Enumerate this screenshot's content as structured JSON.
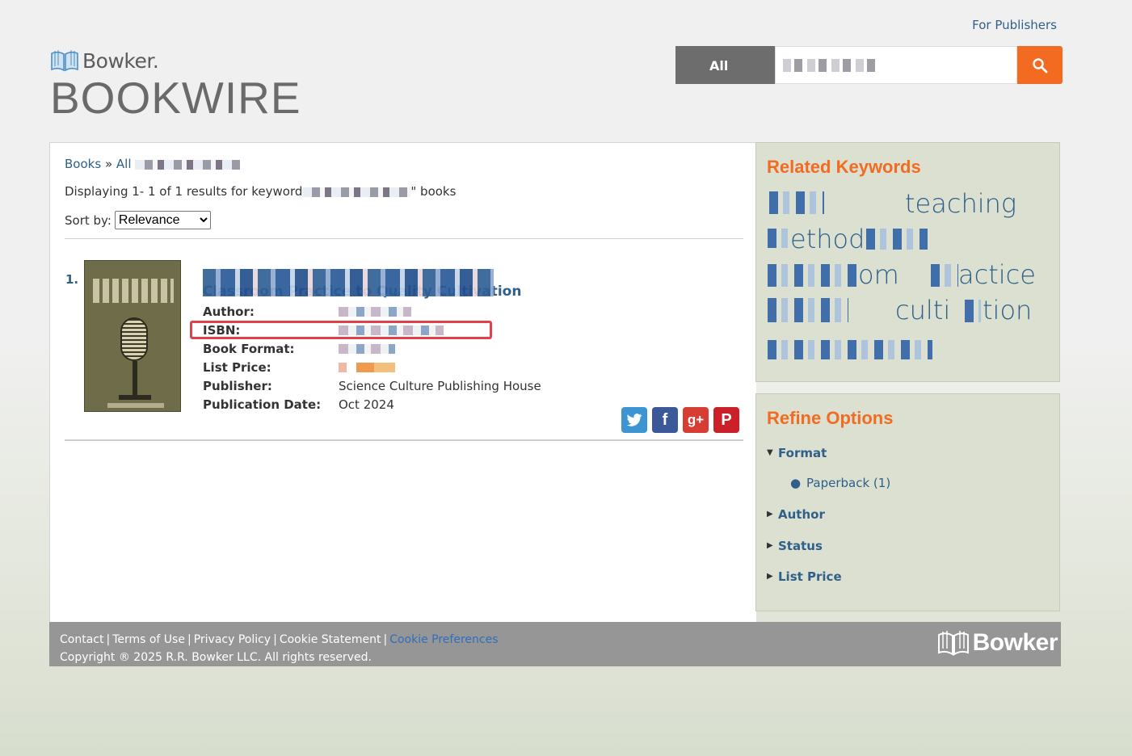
{
  "header": {
    "for_publishers": "For Publishers",
    "logo_small": "Bowker.",
    "logo_big": "BOOKWIRE"
  },
  "search": {
    "category": "All",
    "query": ""
  },
  "breadcrumb": {
    "books": "Books",
    "sep": "»",
    "all": "All"
  },
  "results": {
    "displaying_prefix": "Displaying 1- 1 of 1 results for keyword",
    "displaying_suffix": "\" books",
    "sort_label": "Sort by:",
    "sort_value": "Relevance"
  },
  "book": {
    "number": "1.",
    "title": "Classroom Practice to Quality Cultivation",
    "labels": {
      "author": "Author:",
      "isbn": "ISBN:",
      "format": "Book Format:",
      "price": "List Price:",
      "publisher": "Publisher:",
      "pub_date": "Publication Date:"
    },
    "publisher": "Science Culture Publishing House",
    "pub_date": "Oct 2024"
  },
  "related": {
    "heading": "Related Keywords",
    "keywords": [
      "teaching",
      "ethod",
      "actice",
      "om",
      "culti",
      "tion"
    ]
  },
  "refine": {
    "heading": "Refine Options",
    "format": "Format",
    "paperback": "Paperback",
    "paperback_count": "(1)",
    "author": "Author",
    "status": "Status",
    "list_price": "List Price"
  },
  "footer": {
    "contact": "Contact",
    "terms": "Terms of Use",
    "privacy": "Privacy Policy",
    "cookie_statement": "Cookie Statement",
    "cookie_prefs": "Cookie Preferences",
    "copyright": "Copyright ® 2025 R.R. Bowker LLC. All rights reserved.",
    "logo": "Bowker",
    "pipe": "|"
  },
  "colors": {
    "accent": "#f26b21",
    "link": "#2f5f8a",
    "highlight_box": "#e0414a"
  }
}
